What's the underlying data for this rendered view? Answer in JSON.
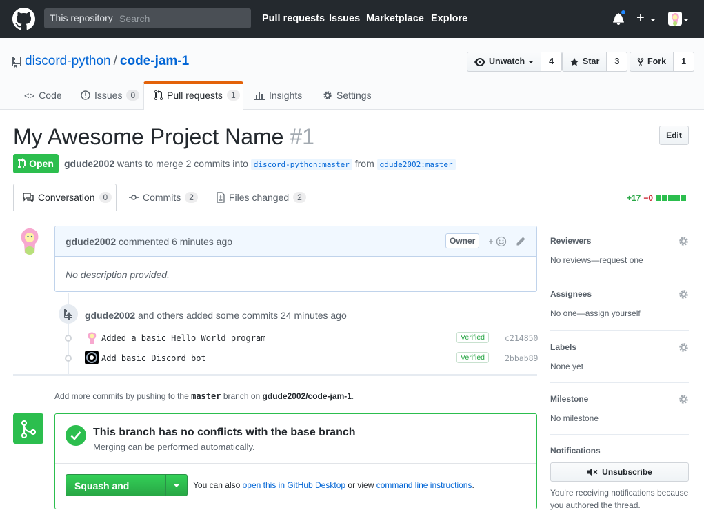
{
  "header": {
    "scope_label": "This repository",
    "search_placeholder": "Search",
    "nav": [
      "Pull requests",
      "Issues",
      "Marketplace",
      "Explore"
    ]
  },
  "repo": {
    "owner": "discord-python",
    "name": "code-jam-1",
    "watch_label": "Unwatch",
    "watch_count": "4",
    "star_label": "Star",
    "star_count": "3",
    "fork_label": "Fork",
    "fork_count": "1",
    "tabs": [
      {
        "label": "Code"
      },
      {
        "label": "Issues",
        "count": "0"
      },
      {
        "label": "Pull requests",
        "count": "1"
      },
      {
        "label": "Insights"
      },
      {
        "label": "Settings"
      }
    ]
  },
  "pr": {
    "title": "My Awesome Project Name",
    "number": "#1",
    "edit_label": "Edit",
    "state": "Open",
    "author": "gdude2002",
    "meta_text": "wants to merge 2 commits into",
    "base_ref": "discord-python:master",
    "from_word": "from",
    "head_ref": "gdude2002:master",
    "tabs": [
      {
        "label": "Conversation",
        "count": "0"
      },
      {
        "label": "Commits",
        "count": "2"
      },
      {
        "label": "Files changed",
        "count": "2"
      }
    ],
    "additions": "+17",
    "deletions": "−0"
  },
  "comment": {
    "author": "gdude2002",
    "action": "commented 6 minutes ago",
    "owner_badge": "Owner",
    "body": "No description provided."
  },
  "commits": {
    "author": "gdude2002",
    "summary": "and others added some commits 24 minutes ago",
    "items": [
      {
        "message": "Added a basic Hello World program",
        "verified": "Verified",
        "sha": "c214850"
      },
      {
        "message": "Add basic Discord bot",
        "verified": "Verified",
        "sha": "2bbab89"
      }
    ]
  },
  "add_more": {
    "prefix": "Add more commits by pushing to the",
    "branch": "master",
    "middle": "branch on",
    "repo": "gdude2002/code-jam-1",
    "suffix": "."
  },
  "merge": {
    "title": "This branch has no conflicts with the base branch",
    "subtitle": "Merging can be performed automatically.",
    "button": "Squash and merge",
    "also_prefix": "You can also",
    "desktop_link": "open this in GitHub Desktop",
    "or_view": "or view",
    "cli_link": "command line instructions",
    "suffix": "."
  },
  "sidebar": {
    "reviewers_h": "Reviewers",
    "reviewers_v": "No reviews—request one",
    "assignees_h": "Assignees",
    "assignees_v": "No one—assign yourself",
    "labels_h": "Labels",
    "labels_v": "None yet",
    "milestone_h": "Milestone",
    "milestone_v": "No milestone",
    "notifications_h": "Notifications",
    "unsubscribe": "Unsubscribe",
    "note": "You’re receiving notifications because you authored the thread."
  },
  "colors": {
    "header_bg": "#24292e",
    "open_green": "#2cbe4e",
    "link_blue": "#0366d6",
    "tab_accent": "#e36209",
    "deletion_red": "#cb2431"
  }
}
